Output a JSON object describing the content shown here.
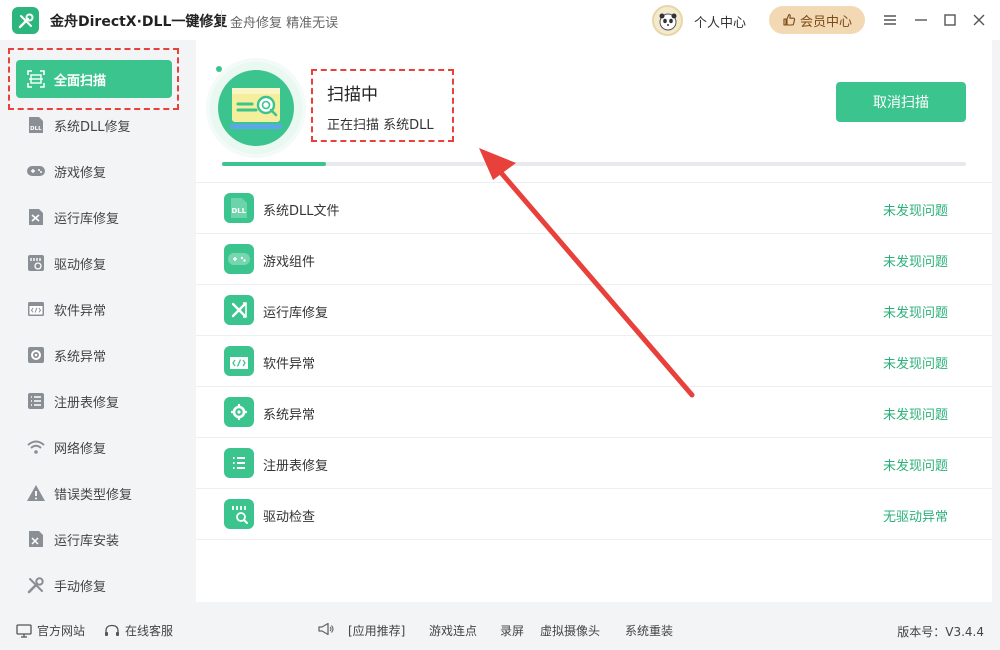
{
  "titlebar": {
    "title": "金舟DirectX·DLL一键修复",
    "slogan": "金舟修复 精准无误",
    "user_center": "个人中心",
    "vip_label": "会员中心"
  },
  "sidebar": {
    "items": [
      {
        "label": "全面扫描",
        "icon": "scan-icon",
        "active": true
      },
      {
        "label": "系统DLL修复",
        "icon": "dll-icon"
      },
      {
        "label": "游戏修复",
        "icon": "gamepad-icon"
      },
      {
        "label": "运行库修复",
        "icon": "runtime-icon"
      },
      {
        "label": "驱动修复",
        "icon": "driver-icon"
      },
      {
        "label": "软件异常",
        "icon": "code-window-icon"
      },
      {
        "label": "系统异常",
        "icon": "gear-icon"
      },
      {
        "label": "注册表修复",
        "icon": "list-icon"
      },
      {
        "label": "网络修复",
        "icon": "wifi-icon"
      },
      {
        "label": "错误类型修复",
        "icon": "warning-icon"
      },
      {
        "label": "运行库安装",
        "icon": "install-icon"
      },
      {
        "label": "手动修复",
        "icon": "wrench-icon"
      }
    ]
  },
  "scan": {
    "title": "扫描中",
    "detail": "正在扫描 系统DLL",
    "cancel_label": "取消扫描",
    "progress": 0.14
  },
  "results": [
    {
      "name": "系统DLL文件",
      "status": "未发现问题",
      "icon": "dll-file-icon"
    },
    {
      "name": "游戏组件",
      "status": "未发现问题",
      "icon": "gamepad-icon"
    },
    {
      "name": "运行库修复",
      "status": "未发现问题",
      "icon": "runtime-icon"
    },
    {
      "name": "软件异常",
      "status": "未发现问题",
      "icon": "code-window-icon"
    },
    {
      "name": "系统异常",
      "status": "未发现问题",
      "icon": "gear-icon"
    },
    {
      "name": "注册表修复",
      "status": "未发现问题",
      "icon": "list-icon"
    },
    {
      "name": "驱动检查",
      "status": "无驱动异常",
      "icon": "driver-check-icon"
    }
  ],
  "footer": {
    "website": "官方网站",
    "support": "在线客服",
    "links": [
      "[应用推荐]",
      "游戏连点",
      "录屏",
      "虚拟摄像头",
      "系统重装"
    ],
    "version": "版本号：V3.4.4"
  },
  "colors": {
    "accent": "#3cc48f",
    "status_ok": "#2bb07a",
    "annotation_red": "#e8413b",
    "vip_bg": "#f3d8b4"
  }
}
